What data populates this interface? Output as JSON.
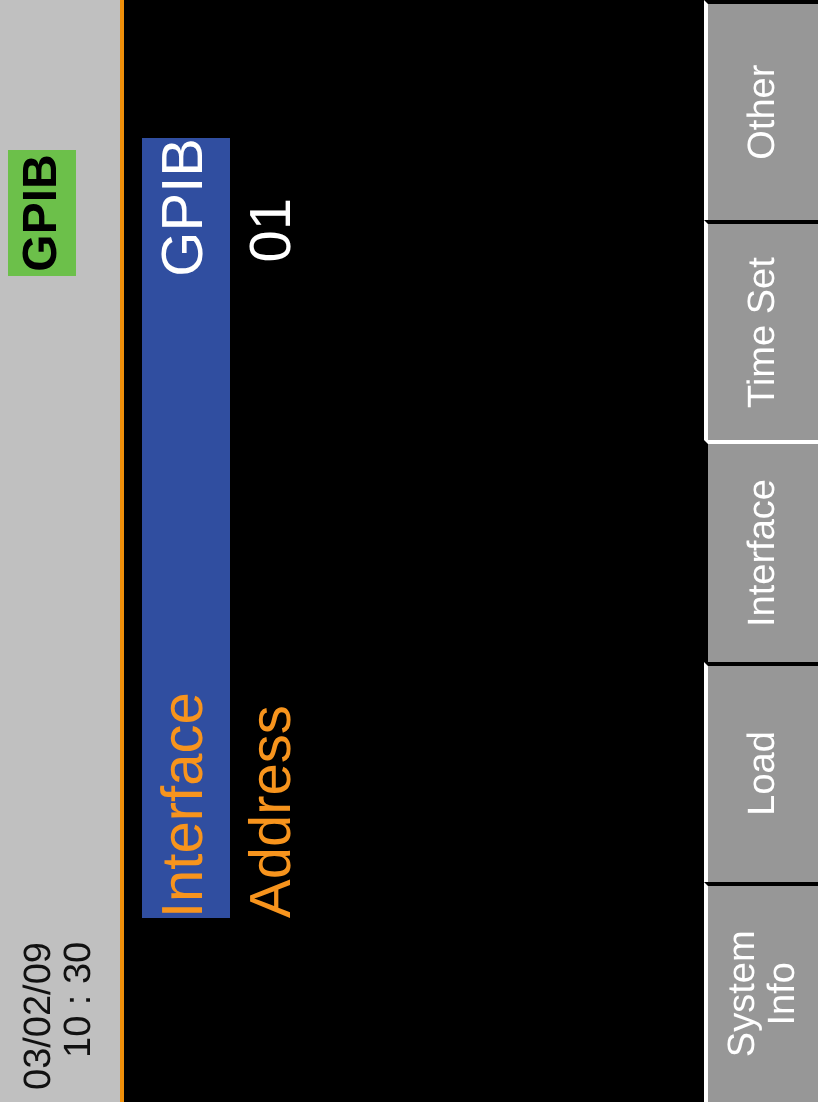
{
  "status_bar": {
    "date": "03/02/09",
    "time": "10 : 30",
    "mode_badge": "GPIB"
  },
  "fields": [
    {
      "label": "Interface",
      "value": "GPIB",
      "selected": true
    },
    {
      "label": "Address",
      "value": "01",
      "selected": false
    }
  ],
  "tabs": [
    {
      "label": "System\nInfo",
      "selected": false
    },
    {
      "label": "Load",
      "selected": false
    },
    {
      "label": "Interface",
      "selected": true
    },
    {
      "label": "Time Set",
      "selected": false
    },
    {
      "label": "Other",
      "selected": false
    }
  ]
}
